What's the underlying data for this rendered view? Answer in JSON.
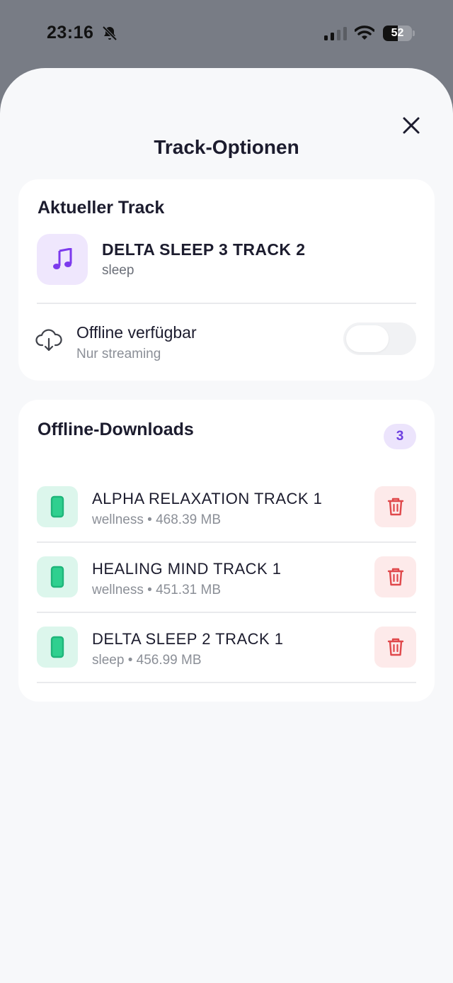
{
  "status_bar": {
    "time": "23:16",
    "battery_level": "52",
    "battery_percent": 52
  },
  "sheet": {
    "title": "Track-Optionen"
  },
  "current_track": {
    "heading": "Aktueller Track",
    "title": "DELTA SLEEP 3 TRACK 2",
    "category": "sleep",
    "offline_label": "Offline verfügbar",
    "offline_sub": "Nur streaming",
    "offline_enabled": false
  },
  "downloads": {
    "heading": "Offline-Downloads",
    "count": "3",
    "items": [
      {
        "title": "ALPHA RELAXATION TRACK 1",
        "category": "wellness",
        "size": "468.39 MB"
      },
      {
        "title": "HEALING MIND TRACK 1",
        "category": "wellness",
        "size": "451.31 MB"
      },
      {
        "title": "DELTA SLEEP 2 TRACK 1",
        "category": "sleep",
        "size": "456.99 MB"
      }
    ]
  },
  "colors": {
    "accent_purple": "#7c3aed",
    "download_green": "#1fb57a",
    "delete_red": "#e0484b"
  }
}
